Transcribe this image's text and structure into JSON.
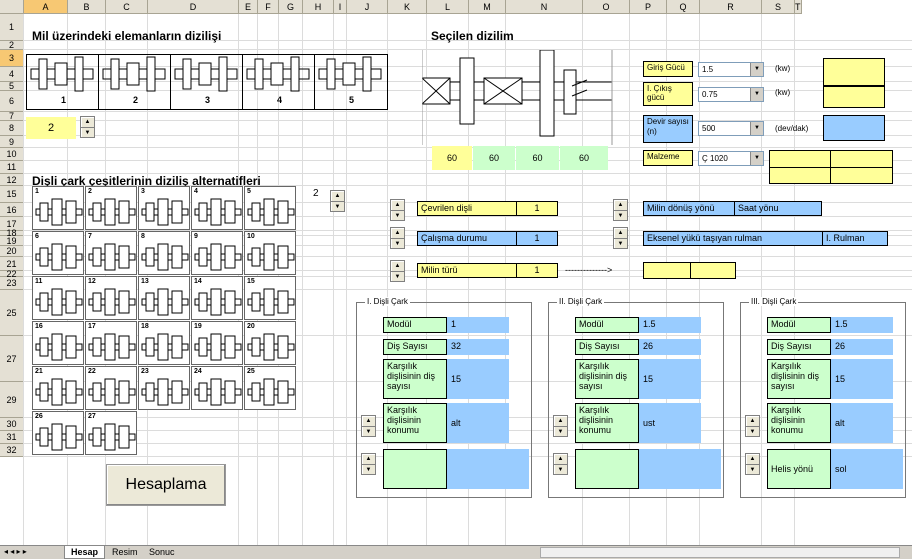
{
  "columns": [
    "A",
    "B",
    "C",
    "D",
    "E",
    "F",
    "G",
    "H",
    "I",
    "J",
    "K",
    "L",
    "M",
    "N",
    "O",
    "P",
    "Q",
    "R",
    "S",
    "T"
  ],
  "rows": [
    "1",
    "2",
    "3",
    "4",
    "5",
    "6",
    "7",
    "8",
    "9",
    "10",
    "11",
    "12",
    "15",
    "16",
    "17",
    "18",
    "19",
    "20",
    "21",
    "22",
    "23",
    "25",
    "27",
    "29",
    "30",
    "31",
    "32"
  ],
  "title_main": "Mil üzerindeki elemanların dizilişi",
  "selected_title": "Seçilen dizilim",
  "arrangement_numbers": [
    "1",
    "2",
    "3",
    "4",
    "5"
  ],
  "selected_arrangement": "2",
  "gear_title": "Dişli çark çeşitlerinin diziliş alternatifleri",
  "gear_numbers": [
    "1",
    "2",
    "3",
    "4",
    "5",
    "6",
    "7",
    "8",
    "9",
    "10",
    "11",
    "12",
    "13",
    "14",
    "15",
    "16",
    "17",
    "18",
    "19",
    "20",
    "21",
    "22",
    "23",
    "24",
    "25",
    "26",
    "27"
  ],
  "selected_gear": "2",
  "dims": [
    "60",
    "60",
    "60",
    "60"
  ],
  "inputs": {
    "giris_label": "Giriş Gücü",
    "giris_val": "1.5",
    "kw1": "(kw)",
    "cikis_label": "I. Çıkış gücü",
    "cikis_val": "0.75",
    "kw2": "(kw)",
    "devir_label": "Devir sayısı (n)",
    "devir_val": "500",
    "unit_dev": "(dev/dak)",
    "malzeme_label": "Malzeme",
    "malzeme_val": "Ç 1020"
  },
  "options": {
    "cevrilen_label": "Çevrilen dişli",
    "cevrilen_val": "1",
    "calisma_label": "Çalışma durumu",
    "calisma_val": "1",
    "milin_label": "Milin türü",
    "milin_val": "1",
    "arrow": "-------------->",
    "donus_label": "Milin dönüş yönü",
    "donus_val": "Saat yönu",
    "eksenel_label": "Eksenel yükü taşıyan rulman",
    "eksenel_val": "I. Rulman"
  },
  "groups": [
    {
      "title": "I. Dişli Çark",
      "modul": "1",
      "dis": "32",
      "karsilik_sayisi": "15",
      "konum_label": "Karşılık dişlisinin konumu",
      "konum": "alt",
      "extra_label": "",
      "extra_val": ""
    },
    {
      "title": "II. Dişli Çark",
      "modul": "1.5",
      "dis": "26",
      "karsilik_sayisi": "15",
      "konum_label": "Karşılık dişlisinin konumu",
      "konum": "ust",
      "extra_label": "",
      "extra_val": ""
    },
    {
      "title": "III. Dişli Çark",
      "modul": "1.5",
      "dis": "26",
      "karsilik_sayisi": "15",
      "konum_label": "Karşılık dişlisinin konumu",
      "konum": "alt",
      "extra_label": "Helis yönü",
      "extra_val": "sol"
    }
  ],
  "labels": {
    "modul": "Modül",
    "dis": "Diş Sayısı",
    "karsilik": "Karşılık dişlisinin diş sayısı"
  },
  "button": "Hesaplama",
  "tabs": [
    "Hesap",
    "Resim",
    "Sonuc"
  ]
}
